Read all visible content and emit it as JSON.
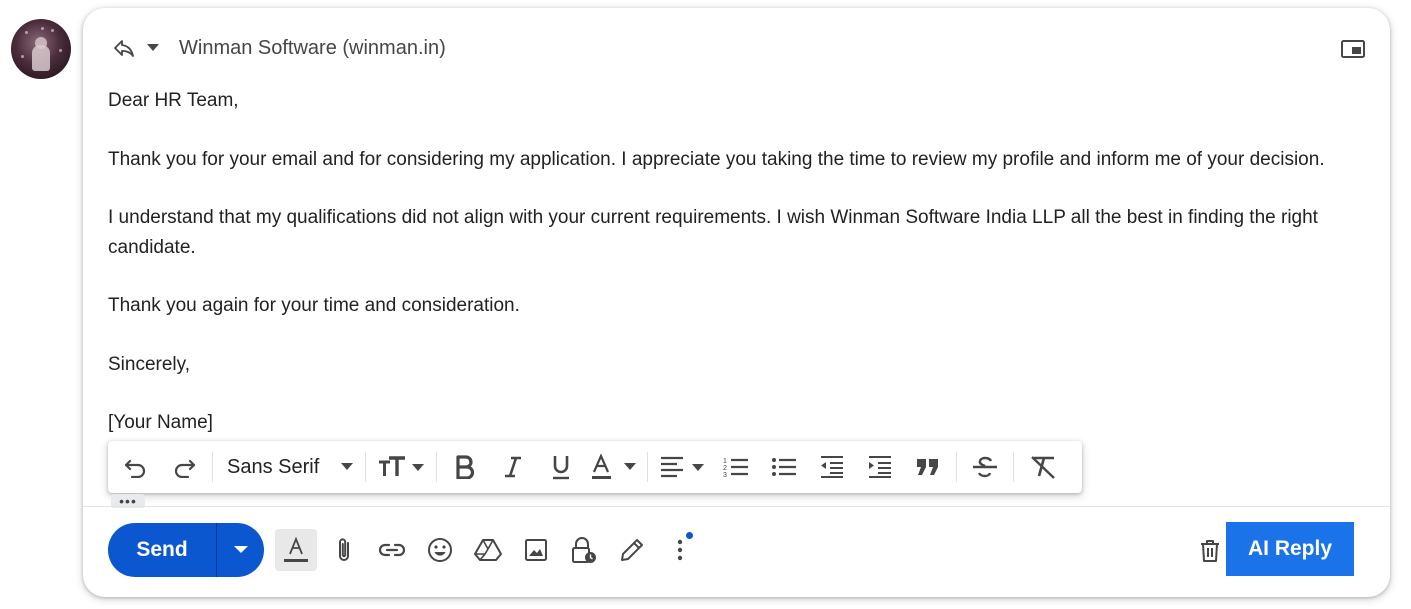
{
  "header": {
    "recipient": "Winman Software (winman.in)",
    "icons": [
      "reply-icon",
      "chevron-down-icon",
      "pop-out-icon"
    ]
  },
  "message": {
    "paragraphs": [
      "Dear HR Team,",
      "Thank you for your email and for considering my application. I appreciate you taking the time to review my profile and inform me of your decision.",
      "I understand that my qualifications did not align with your current requirements. I wish Winman Software India LLP all the best in finding the right candidate.",
      "Thank you again for your time and consideration.",
      "Sincerely,",
      "[Your Name]"
    ]
  },
  "formatting_toolbar": {
    "font": "Sans Serif",
    "icons": [
      "undo-icon",
      "redo-icon",
      "text-size-icon",
      "bold-icon",
      "italic-icon",
      "underline-icon",
      "text-color-icon",
      "align-icon",
      "numbered-list-icon",
      "bulleted-list-icon",
      "indent-less-icon",
      "indent-more-icon",
      "quote-icon",
      "strikethrough-icon",
      "remove-formatting-icon"
    ]
  },
  "show_trimmed": "•••",
  "compose_actions": {
    "send_label": "Send",
    "ai_reply_label": "AI Reply",
    "icons": [
      "formatting-icon",
      "attach-icon",
      "link-icon",
      "emoji-icon",
      "drive-icon",
      "photo-icon",
      "confidential-icon",
      "signature-icon",
      "more-options-icon",
      "trash-icon"
    ]
  },
  "colors": {
    "send_blue": "#0b57d0",
    "ai_reply_blue": "#1a73e8",
    "icon_gray": "#444746",
    "text": "#222222"
  }
}
